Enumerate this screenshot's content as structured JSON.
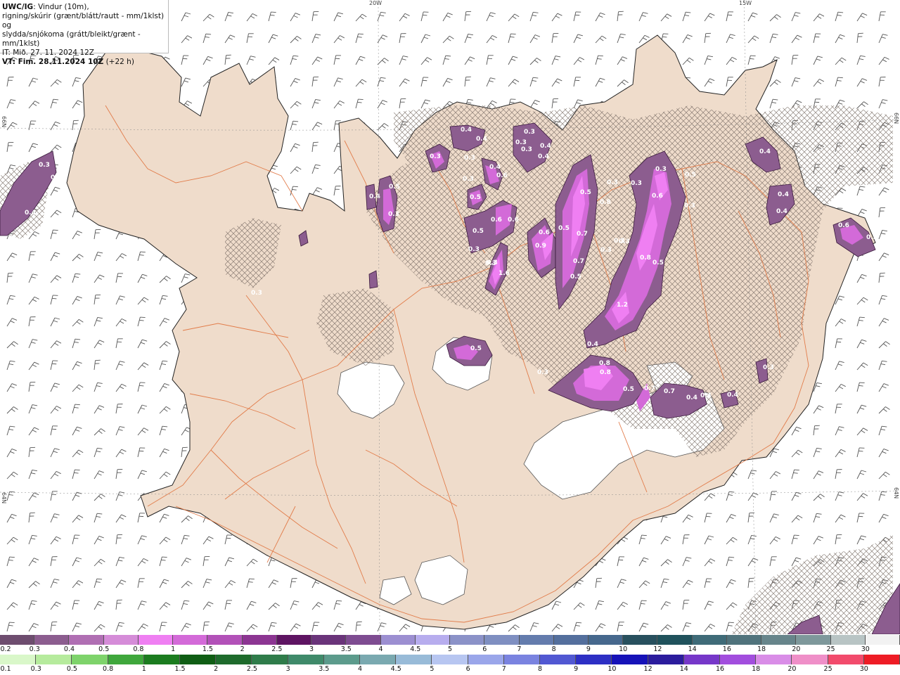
{
  "legend": {
    "source": "UWC/IG",
    "line1": ": Vindur (10m),",
    "line2": "rigning/skúrir (grænt/blátt/rautt - mm/1klst) og",
    "line3": "slydda/snjókoma (grátt/bleikt/grænt - mm/1klst)",
    "it": "IT: Mið. 27. 11. 2024 12Z",
    "vt_label": "VT: Fim. 28.11.2024 10Z",
    "vt_offset": "(+22 h)"
  },
  "grid_labels": {
    "top_20w": "20W",
    "top_15w": "15W",
    "left_66n": "66N",
    "right_66n": "66N",
    "left_64n": "64N",
    "right_64n": "64N"
  },
  "precip_labels": [
    "0.4",
    "0.4",
    "0.3",
    "0.3",
    "0.3",
    "0.4",
    "0.3",
    "0.4",
    "0.3",
    "0.4",
    "0.6",
    "0.5",
    "0.3",
    "0.5",
    "0.4",
    "0.6",
    "0.6",
    "0.5",
    "0.3",
    "0.3",
    "0.3",
    "1.6",
    "0.3",
    "0.9",
    "0.6",
    "0.5",
    "0.7",
    "0.7",
    "0.5",
    "0.5",
    "0.8",
    "0.3",
    "0.3",
    "0.3",
    "0.3",
    "0.6",
    "0.5",
    "0.3",
    "0.3",
    "0.8",
    "0.5",
    "0.3",
    "1.2",
    "0.4",
    "0.7",
    "0.8",
    "0.8",
    "0.5",
    "0.7",
    "0.4",
    "0.4",
    "0.4",
    "0.3",
    "0.5",
    "0.3",
    "0.4",
    "0.4",
    "0.4",
    "0.6",
    "0.3",
    "0.3",
    "0.3",
    "0.4",
    "0.3"
  ],
  "colorbar_top": {
    "labels": [
      "0.2",
      "0.3",
      "0.4",
      "0.5",
      "0.8",
      "1",
      "1.5",
      "2",
      "2.5",
      "3",
      "3.5",
      "4",
      "4.5",
      "5",
      "6",
      "7",
      "8",
      "9",
      "10",
      "12",
      "14",
      "16",
      "18",
      "20",
      "25",
      "30"
    ],
    "colors": [
      "#6e4d6f",
      "#8c5d8f",
      "#b06fb3",
      "#d58cd8",
      "#ef7ff2",
      "#d36ad8",
      "#b251b8",
      "#8c3592",
      "#5e1462",
      "#6a347a",
      "#7e4c91",
      "#9c8fd1",
      "#b7adee",
      "#8b92c8",
      "#7f8fc1",
      "#647cad",
      "#546f9d",
      "#46688d",
      "#28505e",
      "#20525c",
      "#3f6b78",
      "#50737c",
      "#67858b",
      "#7e989b",
      "#b8c4c4",
      "#f2f2f2"
    ]
  },
  "colorbar_bottom": {
    "labels": [
      "0.1",
      "0.3",
      "0.5",
      "0.8",
      "1",
      "1.5",
      "2",
      "2.5",
      "3",
      "3.5",
      "4",
      "4.5",
      "5",
      "6",
      "7",
      "8",
      "9",
      "10",
      "12",
      "14",
      "16",
      "18",
      "20",
      "25",
      "30"
    ],
    "colors": [
      "#d9f7c9",
      "#b6eb9d",
      "#7ed36b",
      "#3fa73c",
      "#1b7c1f",
      "#0f5d14",
      "#1e6b2c",
      "#2f7c4a",
      "#3f8a6a",
      "#5c9b8c",
      "#7aa9b0",
      "#98bbd8",
      "#b7c6f1",
      "#9aa6ea",
      "#7a83e0",
      "#5158d2",
      "#2d2fc4",
      "#1612b8",
      "#2b1c9d",
      "#7637c9",
      "#a24ede",
      "#d98de7",
      "#ef8fc8",
      "#f24b6c",
      "#ee1c25"
    ]
  }
}
